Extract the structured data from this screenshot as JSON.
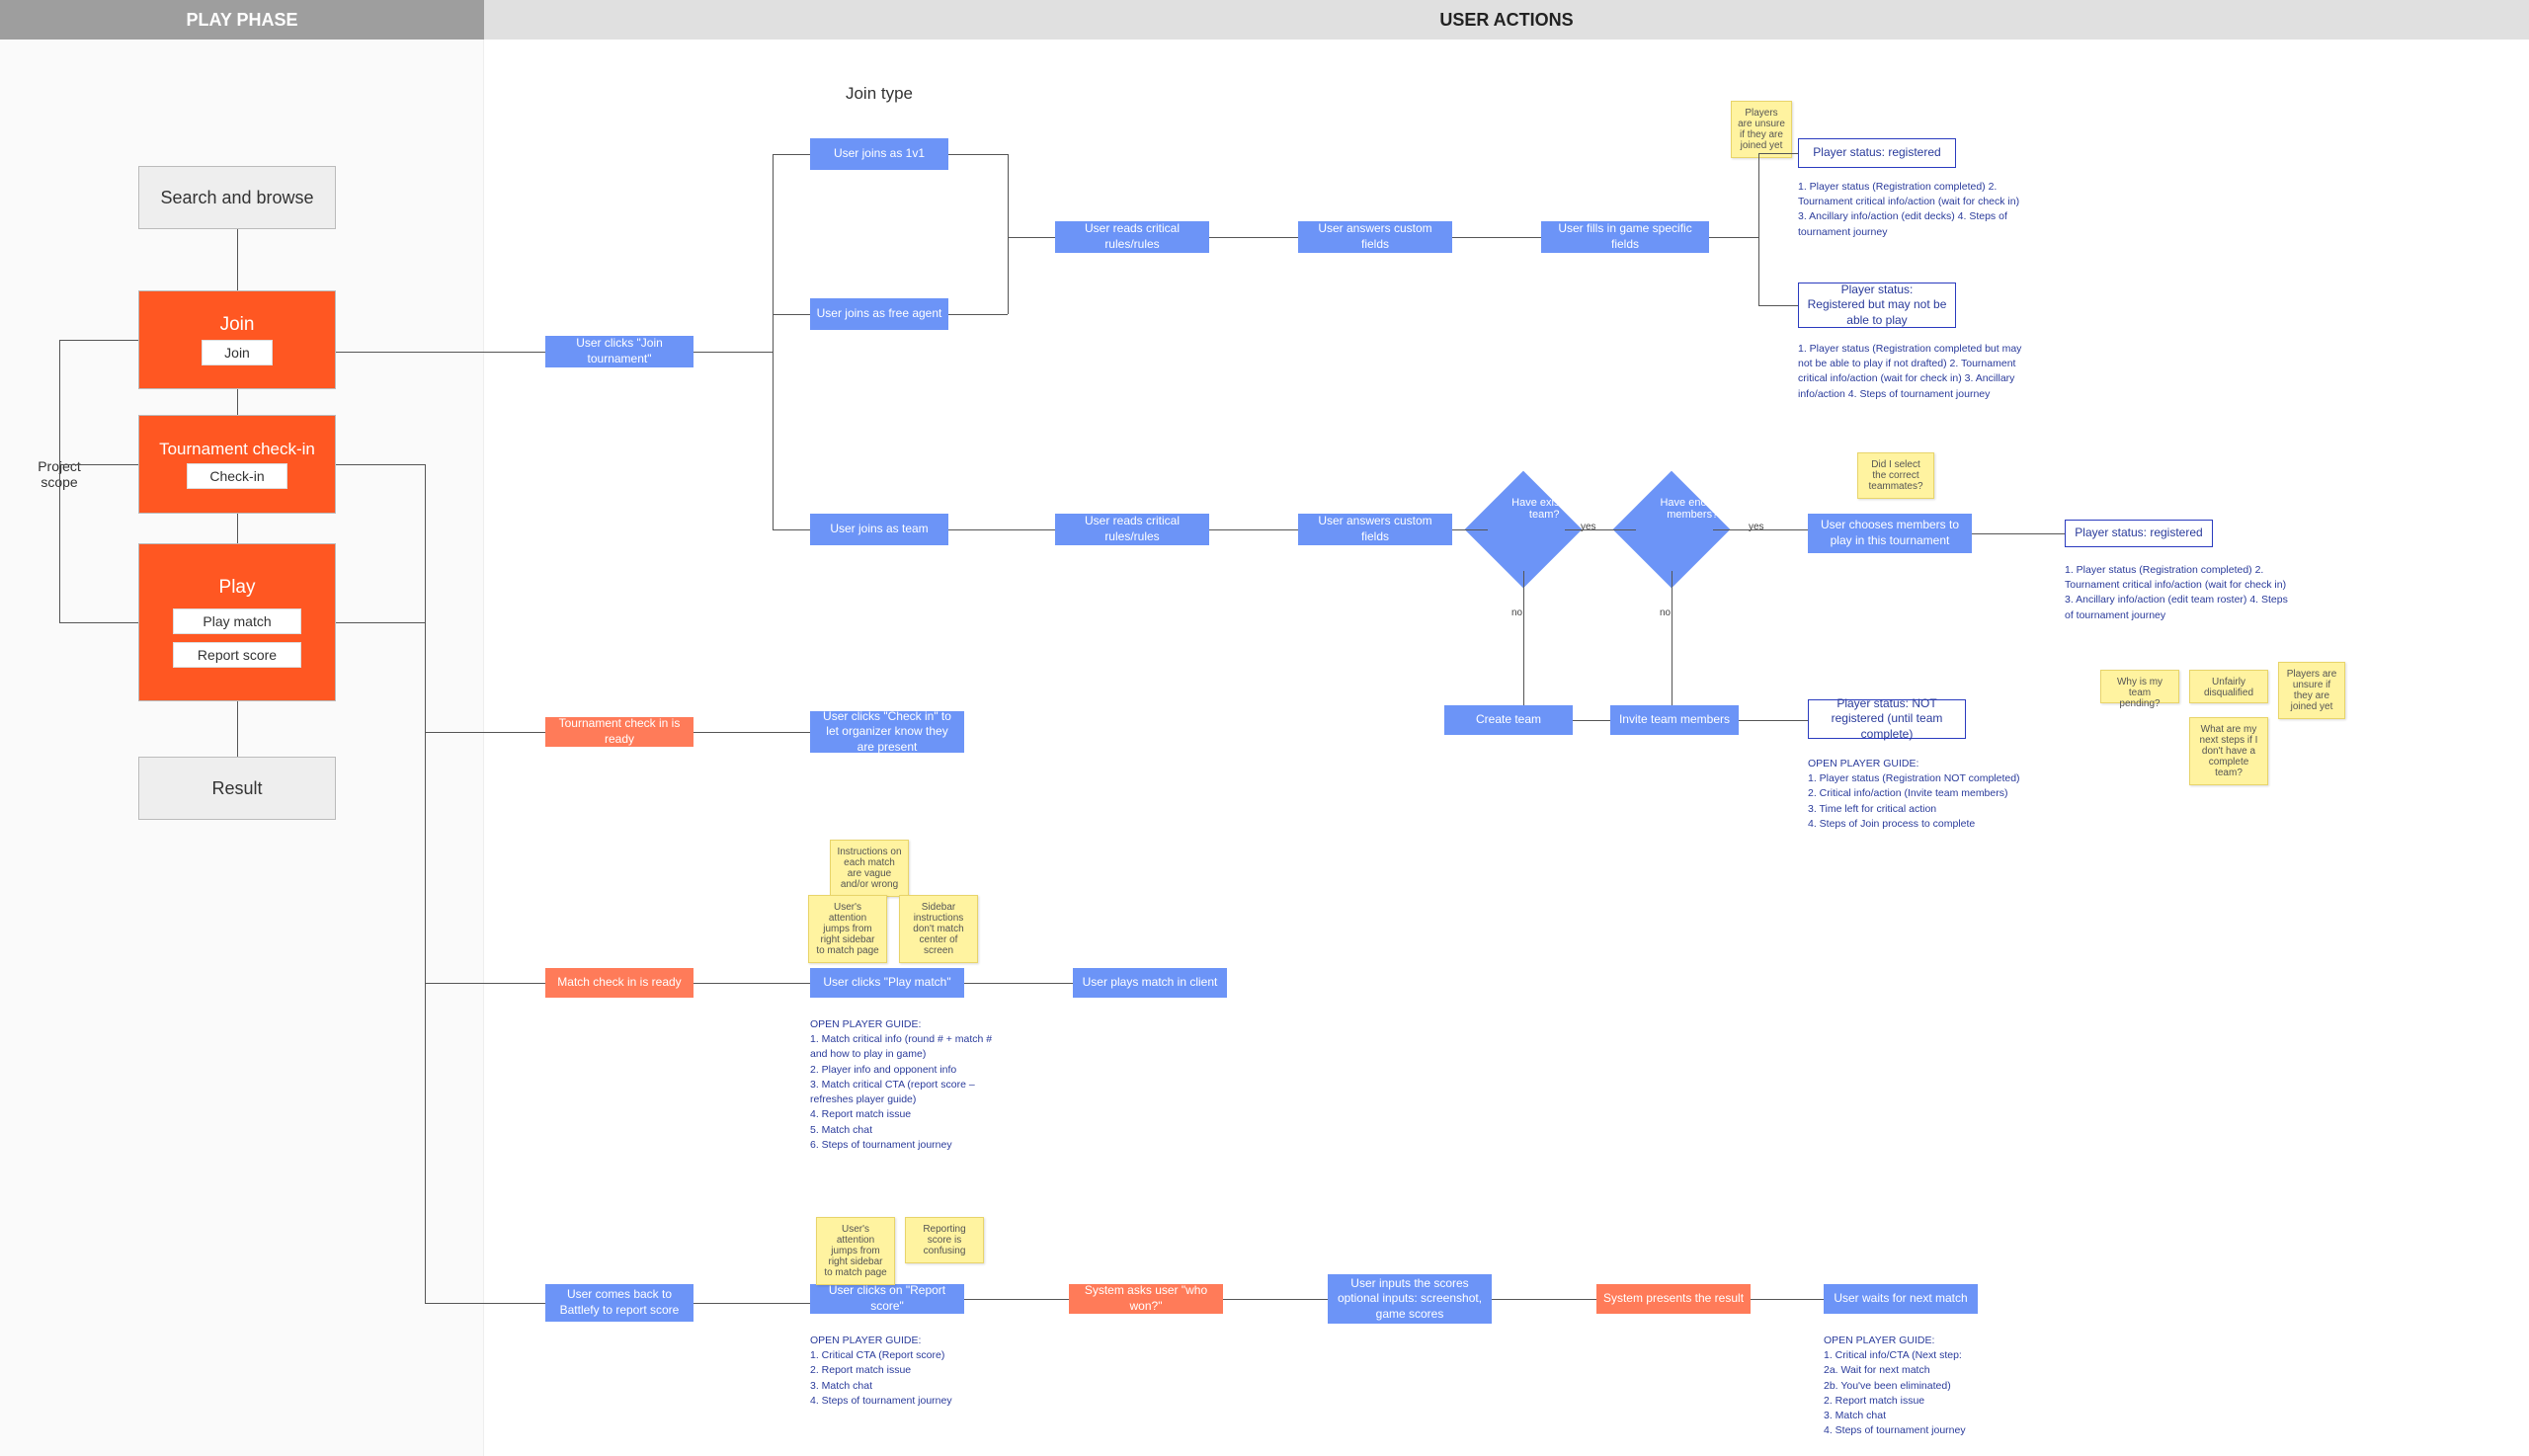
{
  "header": {
    "left": "PLAY PHASE",
    "right": "USER ACTIONS"
  },
  "scope_label": "Project scope",
  "phases": {
    "search": "Search and browse",
    "join": {
      "title": "Join",
      "sub": "Join"
    },
    "checkin": {
      "title": "Tournament check-in",
      "sub": "Check-in"
    },
    "play": {
      "title": "Play",
      "subs": [
        "Play match",
        "Report score"
      ]
    },
    "result": "Result"
  },
  "join_type_label": "Join type",
  "edges": {
    "yes1": "yes",
    "yes2": "yes",
    "no1": "no",
    "no2": "no"
  },
  "nodes": {
    "click_join": "User clicks \"Join tournament\"",
    "join_1v1": "User joins as 1v1",
    "join_free_agent": "User joins as free agent",
    "reads_rules1": "User reads critical rules/rules",
    "answers_custom1": "User answers custom fields",
    "fills_game": "User fills in game specific fields",
    "status_reg1": "Player status: registered",
    "status_reg_maybe": "Player status:\nRegistered but may not be able to play",
    "join_team": "User joins as team",
    "reads_rules2": "User reads critical rules/rules",
    "answers_custom2": "User answers custom fields",
    "have_existing": "Have existing team?",
    "have_enough": "Have enough members?",
    "choose_members": "User chooses members to play in this tournament",
    "status_reg2": "Player status: registered",
    "create_team": "Create team",
    "invite_members": "Invite team members",
    "status_not_reg": "Player status: NOT registered (until team complete)",
    "tci_ready": "Tournament check in is ready",
    "click_checkin": "User clicks \"Check in\" to let organizer know they are present",
    "mci_ready": "Match check in is ready",
    "click_play": "User clicks \"Play match\"",
    "plays_client": "User plays match in client",
    "return_report": "User comes back to Battlefy to report score",
    "click_report": "User clicks on \"Report score\"",
    "system_who_won": "System asks user \"who won?\"",
    "inputs_scores": "User inputs the scores\noptional inputs: screenshot, game scores",
    "system_result": "System presents the result",
    "wait_next": "User waits for next match"
  },
  "guides": {
    "g1": "1. Player status (Registration completed)\n2. Tournament critical info/action (wait for check in)\n3. Ancillary info/action (edit decks)\n4. Steps of tournament journey",
    "g2": "1. Player status (Registration completed but may not be able to play if not drafted)\n2. Tournament critical info/action (wait for check in)\n3. Ancillary info/action\n4. Steps of tournament journey",
    "g3": "1. Player status (Registration completed)\n2. Tournament critical info/action (wait for check in)\n3. Ancillary info/action (edit team roster)\n4. Steps of tournament journey",
    "g4": "OPEN PLAYER GUIDE:\n1. Player status (Registration NOT completed)\n2. Critical info/action (Invite team members)\n3. Time left for critical action\n4. Steps of Join process to complete",
    "g5": "OPEN PLAYER GUIDE:\n1. Match critical info (round # + match # and how to play in game)\n2. Player info and opponent info\n3. Match critical CTA (report score – refreshes player guide)\n4. Report match issue\n5. Match chat\n6. Steps of tournament journey",
    "g6": "OPEN PLAYER GUIDE:\n1. Critical CTA (Report score)\n2. Report match issue\n3. Match chat\n4. Steps of tournament journey",
    "g7": "OPEN PLAYER GUIDE:\n1. Critical info/CTA (Next step:\n   2a. Wait for next match\n   2b. You've been eliminated)\n2. Report match issue\n3. Match chat\n4. Steps of tournament journey"
  },
  "stickies": {
    "s_topright": "Players are unsure if they are joined yet",
    "s_team": "Did I select the correct teammates?",
    "s_pending": "Why is my team pending?",
    "s_dq": "Unfairly disqualified",
    "s_joined2": "Players are unsure if they are joined yet",
    "s_complete": "What are my next steps if I don't have a complete team?",
    "s_instr": "Instructions on each match are vague and/or wrong",
    "s_attn1": "User's attention jumps from right sidebar to match page",
    "s_sb_mismatch": "Sidebar instructions don't match center of screen",
    "s_attn2": "User's attention jumps from right sidebar to match page",
    "s_report": "Reporting score is confusing"
  }
}
